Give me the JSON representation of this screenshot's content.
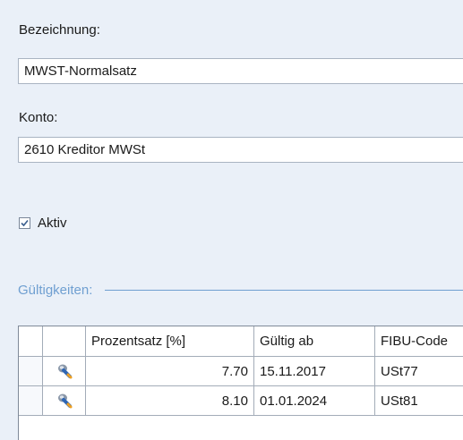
{
  "bezeichnung": {
    "label": "Bezeichnung:",
    "value": "MWST-Normalsatz"
  },
  "konto": {
    "label": "Konto:",
    "value": "2610 Kreditor MWSt"
  },
  "aktiv": {
    "label": "Aktiv",
    "checked": true
  },
  "gueltigkeiten": {
    "title": "Gültigkeiten:",
    "columns": {
      "prozentsatz": "Prozentsatz [%]",
      "gueltig_ab": "Gültig ab",
      "fibu_code": "FIBU-Code"
    },
    "rows": [
      {
        "icon": "edit-record-icon",
        "prozentsatz": "7.70",
        "gueltig_ab": "15.11.2017",
        "fibu_code": "USt77"
      },
      {
        "icon": "edit-record-icon",
        "prozentsatz": "8.10",
        "gueltig_ab": "01.01.2024",
        "fibu_code": "USt81"
      }
    ]
  }
}
